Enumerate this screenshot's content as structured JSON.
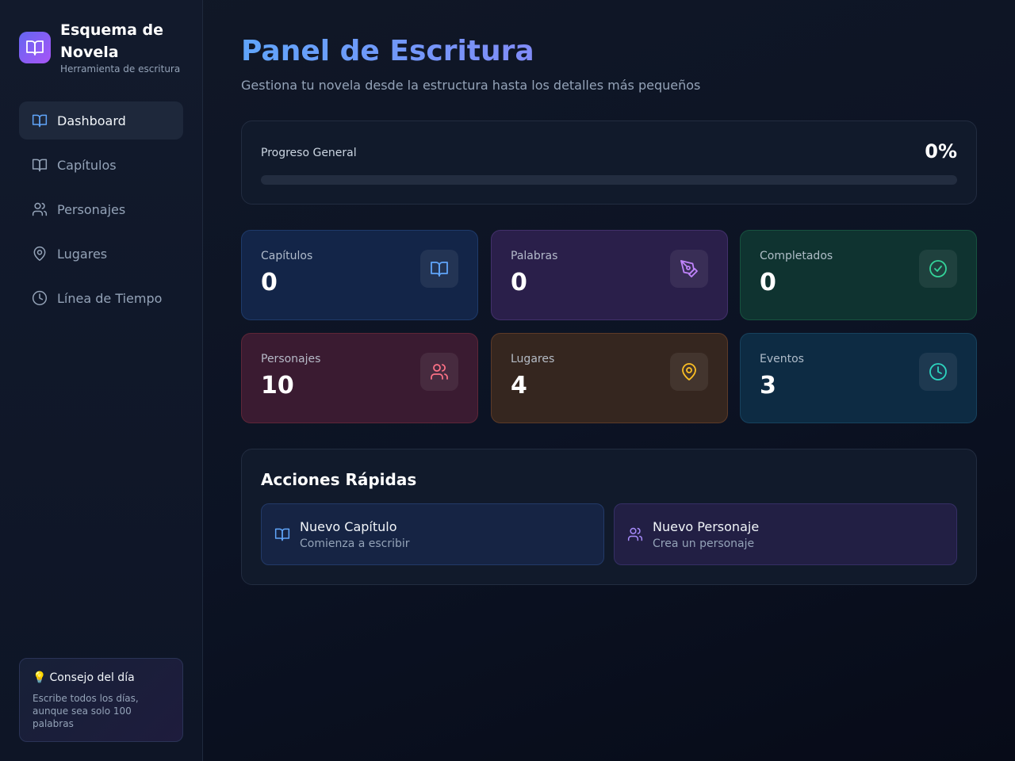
{
  "brand": {
    "title": "Esquema de Novela",
    "subtitle": "Herramienta de escritura",
    "icon": "book-open-icon"
  },
  "nav": {
    "items": [
      {
        "label": "Dashboard",
        "icon": "book-open-icon",
        "active": true
      },
      {
        "label": "Capítulos",
        "icon": "book-open-icon",
        "active": false
      },
      {
        "label": "Personajes",
        "icon": "users-icon",
        "active": false
      },
      {
        "label": "Lugares",
        "icon": "map-pin-icon",
        "active": false
      },
      {
        "label": "Línea de Tiempo",
        "icon": "clock-icon",
        "active": false
      }
    ]
  },
  "tip": {
    "bulb": "💡",
    "title": "Consejo del día",
    "text": "Escribe todos los días, aunque sea solo 100 palabras"
  },
  "header": {
    "title": "Panel de Escritura",
    "subtitle": "Gestiona tu novela desde la estructura hasta los detalles más pequeños"
  },
  "progress": {
    "label": "Progreso General",
    "percent_text": "0%",
    "value": 0
  },
  "stats": [
    {
      "label": "Capítulos",
      "value": "0",
      "icon": "book-open-icon",
      "color": "#60a5fa"
    },
    {
      "label": "Palabras",
      "value": "0",
      "icon": "pen-tool-icon",
      "color": "#c084fc"
    },
    {
      "label": "Completados",
      "value": "0",
      "icon": "check-circle-icon",
      "color": "#34d399"
    },
    {
      "label": "Personajes",
      "value": "10",
      "icon": "users-icon",
      "color": "#fb7185"
    },
    {
      "label": "Lugares",
      "value": "4",
      "icon": "map-pin-icon",
      "color": "#fbbf24"
    },
    {
      "label": "Eventos",
      "value": "3",
      "icon": "clock-icon",
      "color": "#2dd4bf"
    }
  ],
  "quick_actions": {
    "title": "Acciones Rápidas",
    "items": [
      {
        "title": "Nuevo Capítulo",
        "subtitle": "Comienza a escribir",
        "icon": "book-open-icon",
        "color": "#60a5fa"
      },
      {
        "title": "Nuevo Personaje",
        "subtitle": "Crea un personaje",
        "icon": "users-icon",
        "color": "#a78bfa"
      }
    ]
  }
}
